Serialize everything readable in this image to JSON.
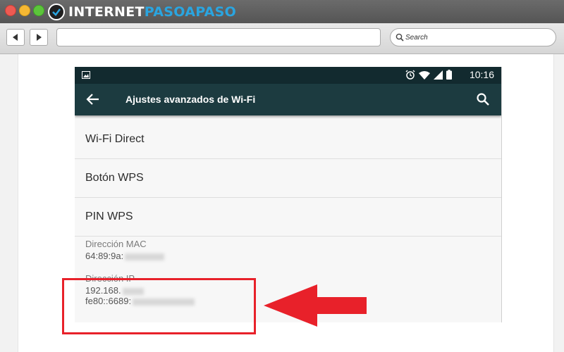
{
  "browser": {
    "logo_part1": "INTERNET",
    "logo_part2": "PASOAPASO",
    "search_placeholder": "Search"
  },
  "phone": {
    "status_time": "10:16",
    "app_title": "Ajustes avanzados de Wi-Fi",
    "settings_items": [
      {
        "label": "Wi-Fi Direct"
      },
      {
        "label": "Botón WPS"
      },
      {
        "label": "PIN WPS"
      }
    ],
    "mac": {
      "label": "Dirección MAC",
      "value_visible": "64:89:9a:"
    },
    "ip": {
      "label": "Dirección IP",
      "value_visible_1": "192.168.",
      "value_visible_2": "fe80::6689:"
    }
  },
  "colors": {
    "status_bar": "#122a2f",
    "app_bar": "#1c3b40",
    "highlight": "#e8212a",
    "logo_accent": "#2aa5e0"
  },
  "icons": [
    "image-icon",
    "alarm-icon",
    "wifi-icon",
    "signal-icon",
    "battery-icon",
    "back-arrow-icon",
    "search-icon",
    "red-arrow-icon"
  ]
}
